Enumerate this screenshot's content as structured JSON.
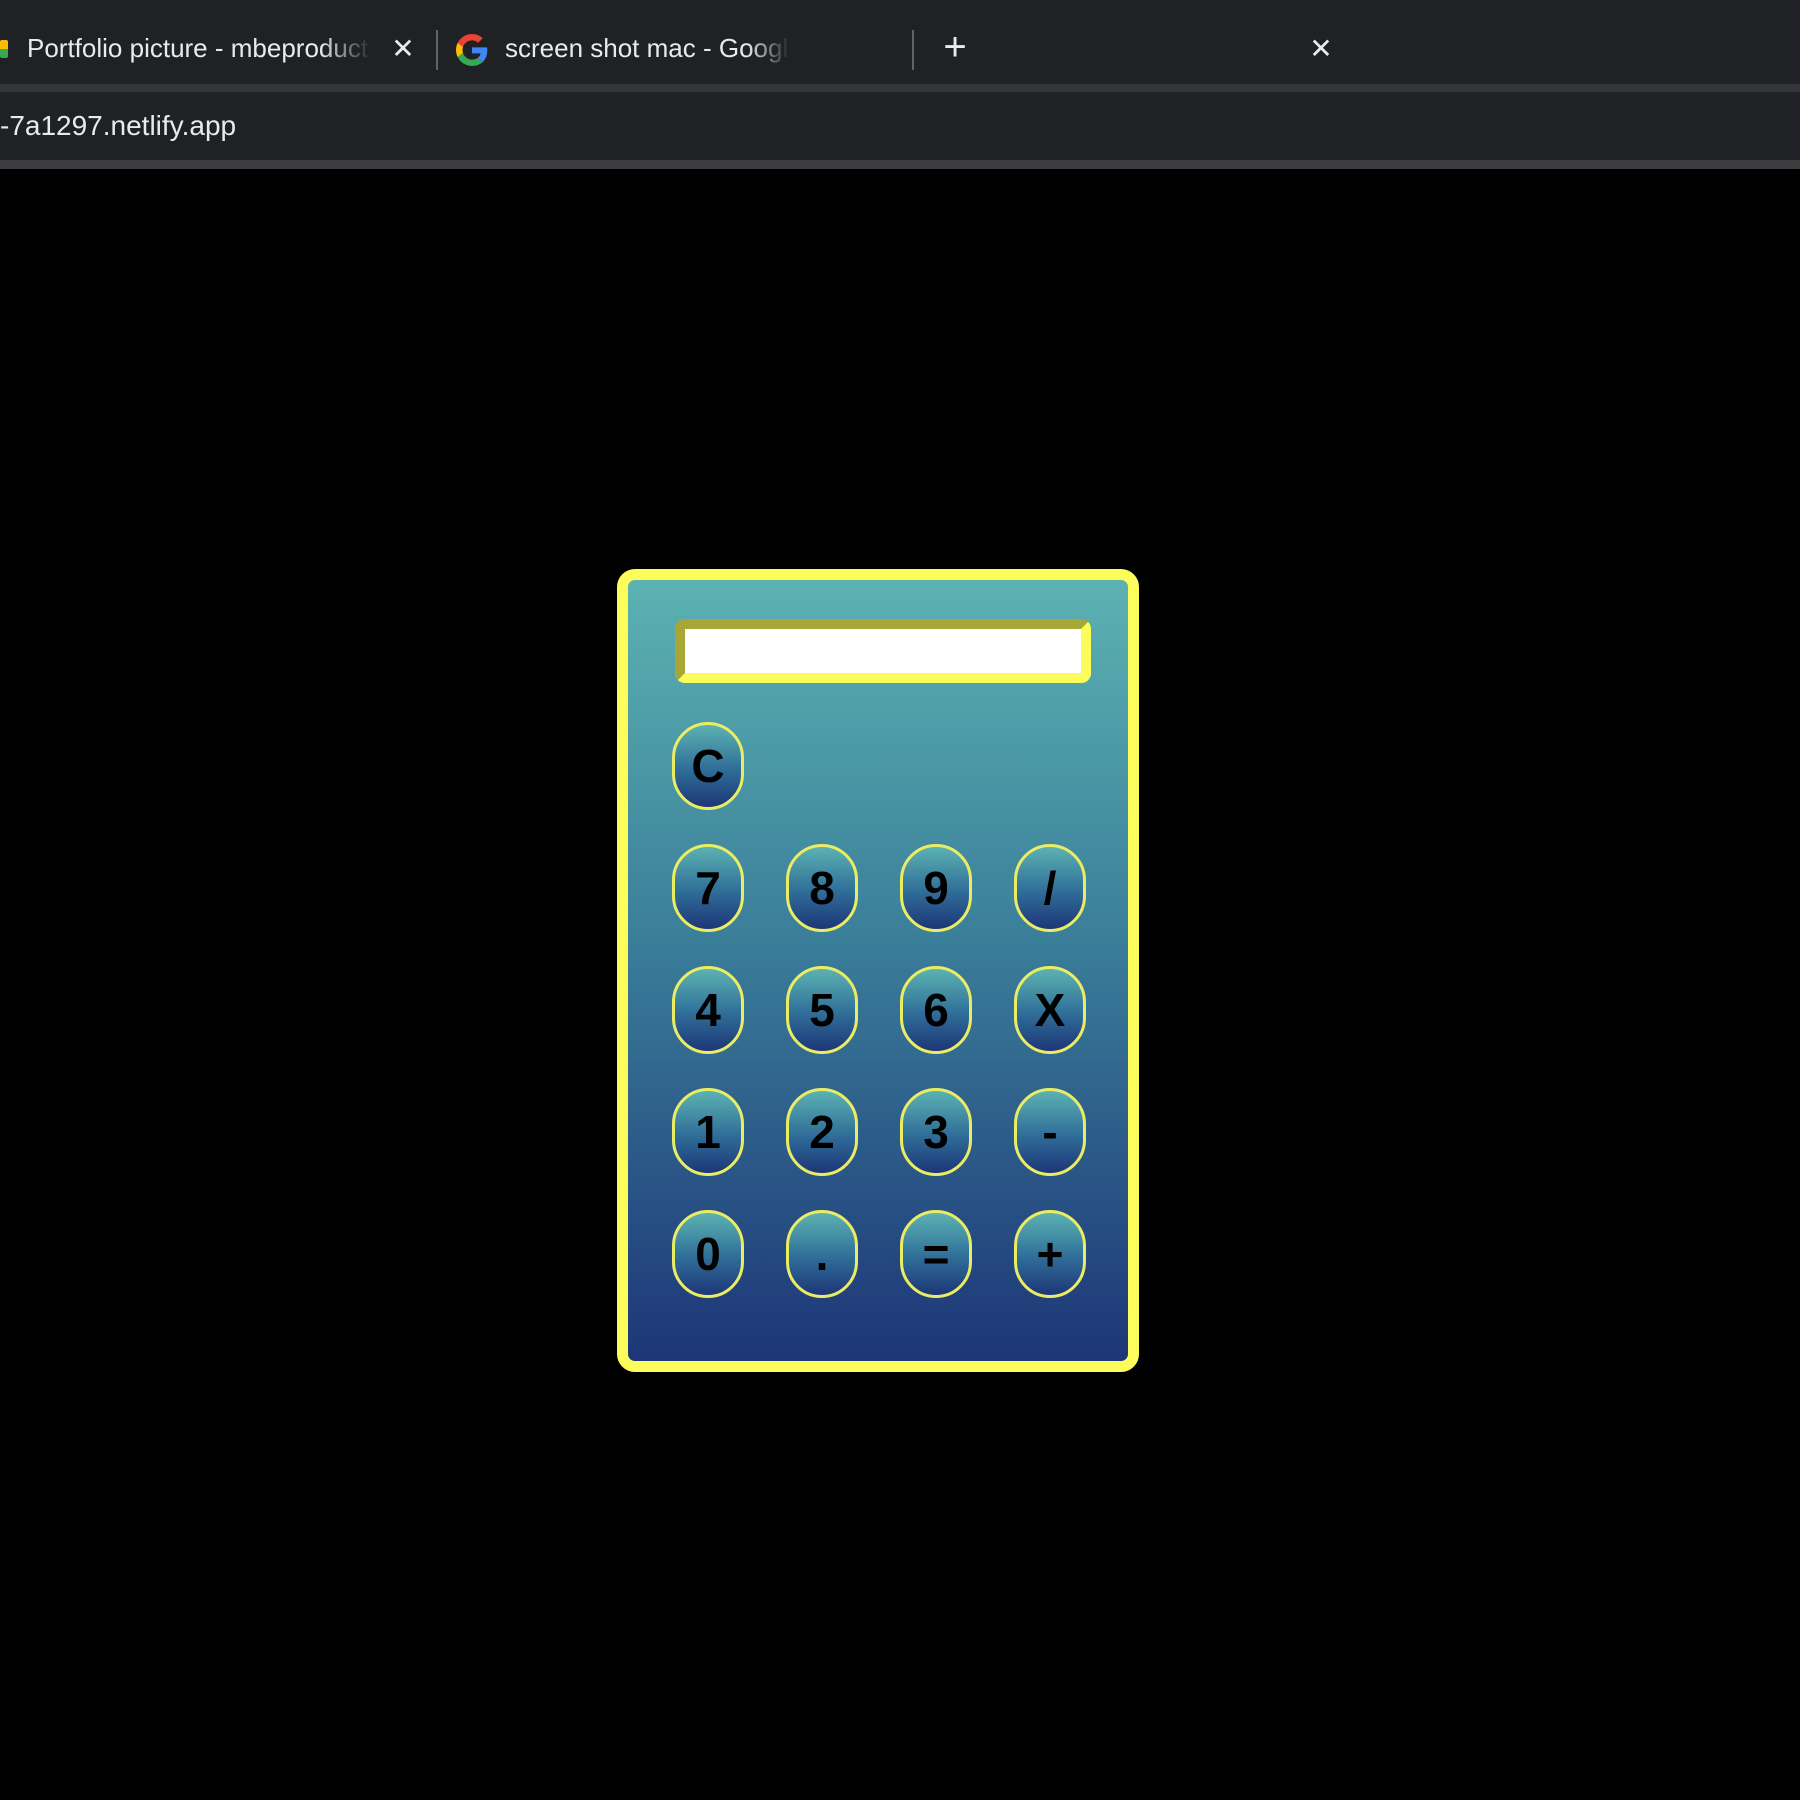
{
  "browser": {
    "tabs": [
      {
        "title": "Portfolio picture - mbeproduct",
        "favicon": "google-drive-icon"
      },
      {
        "title": "screen shot mac - Google Sea",
        "favicon": "google-g-icon"
      }
    ],
    "close_glyph": "✕",
    "new_tab_glyph": "+",
    "url": "-7a1297.netlify.app"
  },
  "calculator": {
    "display_value": "",
    "colors": {
      "border": "#fcfd5a",
      "gradient_top": "#5cb2b2",
      "gradient_bottom": "#1d3677",
      "key_text": "#000000",
      "page_background": "#000000"
    },
    "keys": {
      "clear": "C",
      "seven": "7",
      "eight": "8",
      "nine": "9",
      "divide": "/",
      "four": "4",
      "five": "5",
      "six": "6",
      "multiply": "X",
      "one": "1",
      "two": "2",
      "three": "3",
      "subtract": "-",
      "zero": "0",
      "decimal": ".",
      "equals": "=",
      "add": "+"
    }
  }
}
